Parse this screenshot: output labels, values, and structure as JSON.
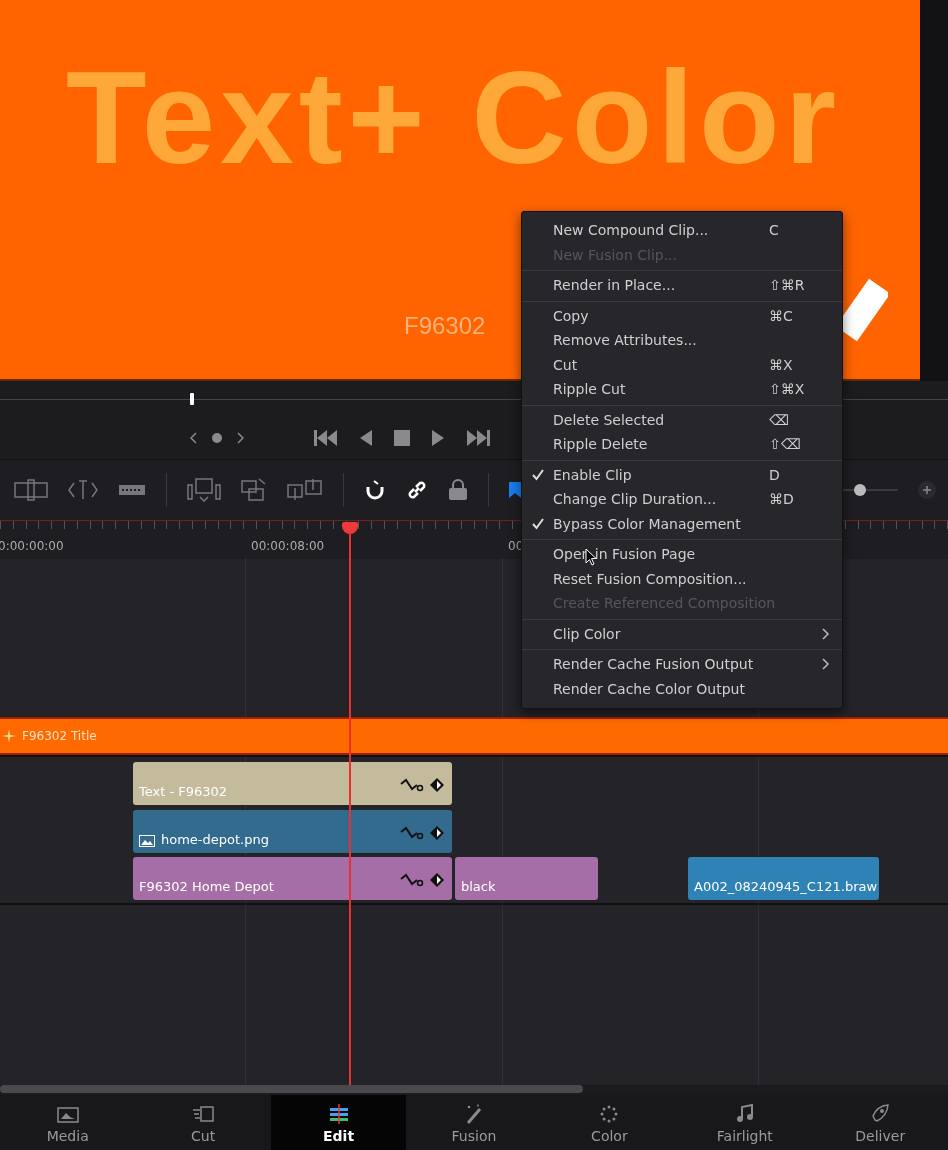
{
  "viewer": {
    "title": "Text+ Color",
    "caption": "F96302"
  },
  "timeline": {
    "timecodes": [
      "0:00:00:00",
      "00:00:08:00",
      "00"
    ],
    "zoom": {
      "level": 0.4
    },
    "tracks": [
      {
        "clips": [
          {
            "label": "F96302 Title",
            "kind": "title",
            "color": "#ff6a00",
            "keyframes": false
          }
        ]
      },
      {
        "clips": [
          {
            "label": "Text - F96302",
            "kind": "text",
            "color": "#c4bb9c",
            "keyframes": true
          }
        ]
      },
      {
        "clips": [
          {
            "label": "home-depot.png",
            "kind": "image",
            "color": "#336b8f",
            "keyframes": true
          }
        ]
      },
      {
        "clips": [
          {
            "label": "F96302 Home Depot",
            "kind": "video",
            "color": "#a66ea6",
            "keyframes": true
          },
          {
            "label": "black",
            "kind": "video",
            "color": "#a66ea6",
            "keyframes": false
          },
          {
            "label": "A002_08240945_C121.braw",
            "kind": "video",
            "color": "#2f82b5",
            "keyframes": false
          }
        ]
      }
    ]
  },
  "context_menu": {
    "groups": [
      {
        "items": [
          {
            "label": "New Compound Clip...",
            "shortcut": "C",
            "checked": false,
            "disabled": false,
            "submenu": false
          },
          {
            "label": "New Fusion Clip...",
            "checked": false,
            "disabled": true,
            "submenu": false
          }
        ]
      },
      {
        "items": [
          {
            "label": "Render in Place...",
            "shortcut": "⇧⌘R",
            "checked": false,
            "disabled": false,
            "submenu": false
          }
        ]
      },
      {
        "items": [
          {
            "label": "Copy",
            "shortcut": "⌘C",
            "checked": false,
            "disabled": false,
            "submenu": false
          },
          {
            "label": "Remove Attributes...",
            "checked": false,
            "disabled": false,
            "submenu": false
          },
          {
            "label": "Cut",
            "shortcut": "⌘X",
            "checked": false,
            "disabled": false,
            "submenu": false
          },
          {
            "label": "Ripple Cut",
            "shortcut": "⇧⌘X",
            "checked": false,
            "disabled": false,
            "submenu": false
          }
        ]
      },
      {
        "items": [
          {
            "label": "Delete Selected",
            "shortcut": "⌫",
            "checked": false,
            "disabled": false,
            "submenu": false
          },
          {
            "label": "Ripple Delete",
            "shortcut": "⇧⌫",
            "checked": false,
            "disabled": false,
            "submenu": false
          }
        ]
      },
      {
        "items": [
          {
            "label": "Enable Clip",
            "shortcut": "D",
            "checked": true,
            "disabled": false,
            "submenu": false
          },
          {
            "label": "Change Clip Duration...",
            "shortcut": "⌘D",
            "checked": false,
            "disabled": false,
            "submenu": false
          },
          {
            "label": "Bypass Color Management",
            "checked": true,
            "disabled": false,
            "submenu": false
          }
        ]
      },
      {
        "items": [
          {
            "label": "Open in Fusion Page",
            "checked": false,
            "disabled": false,
            "submenu": false
          },
          {
            "label": "Reset Fusion Composition...",
            "checked": false,
            "disabled": false,
            "submenu": false
          },
          {
            "label": "Create Referenced Composition",
            "checked": false,
            "disabled": true,
            "submenu": false
          }
        ]
      },
      {
        "items": [
          {
            "label": "Clip Color",
            "checked": false,
            "disabled": false,
            "submenu": true
          }
        ]
      },
      {
        "items": [
          {
            "label": "Render Cache Fusion Output",
            "checked": false,
            "disabled": false,
            "submenu": true
          },
          {
            "label": "Render Cache Color Output",
            "checked": false,
            "disabled": false,
            "submenu": false
          }
        ]
      }
    ]
  },
  "pages": [
    {
      "label": "Media",
      "selected": false
    },
    {
      "label": "Cut",
      "selected": false
    },
    {
      "label": "Edit",
      "selected": true
    },
    {
      "label": "Fusion",
      "selected": false
    },
    {
      "label": "Color",
      "selected": false
    },
    {
      "label": "Fairlight",
      "selected": false
    },
    {
      "label": "Deliver",
      "selected": false
    }
  ]
}
